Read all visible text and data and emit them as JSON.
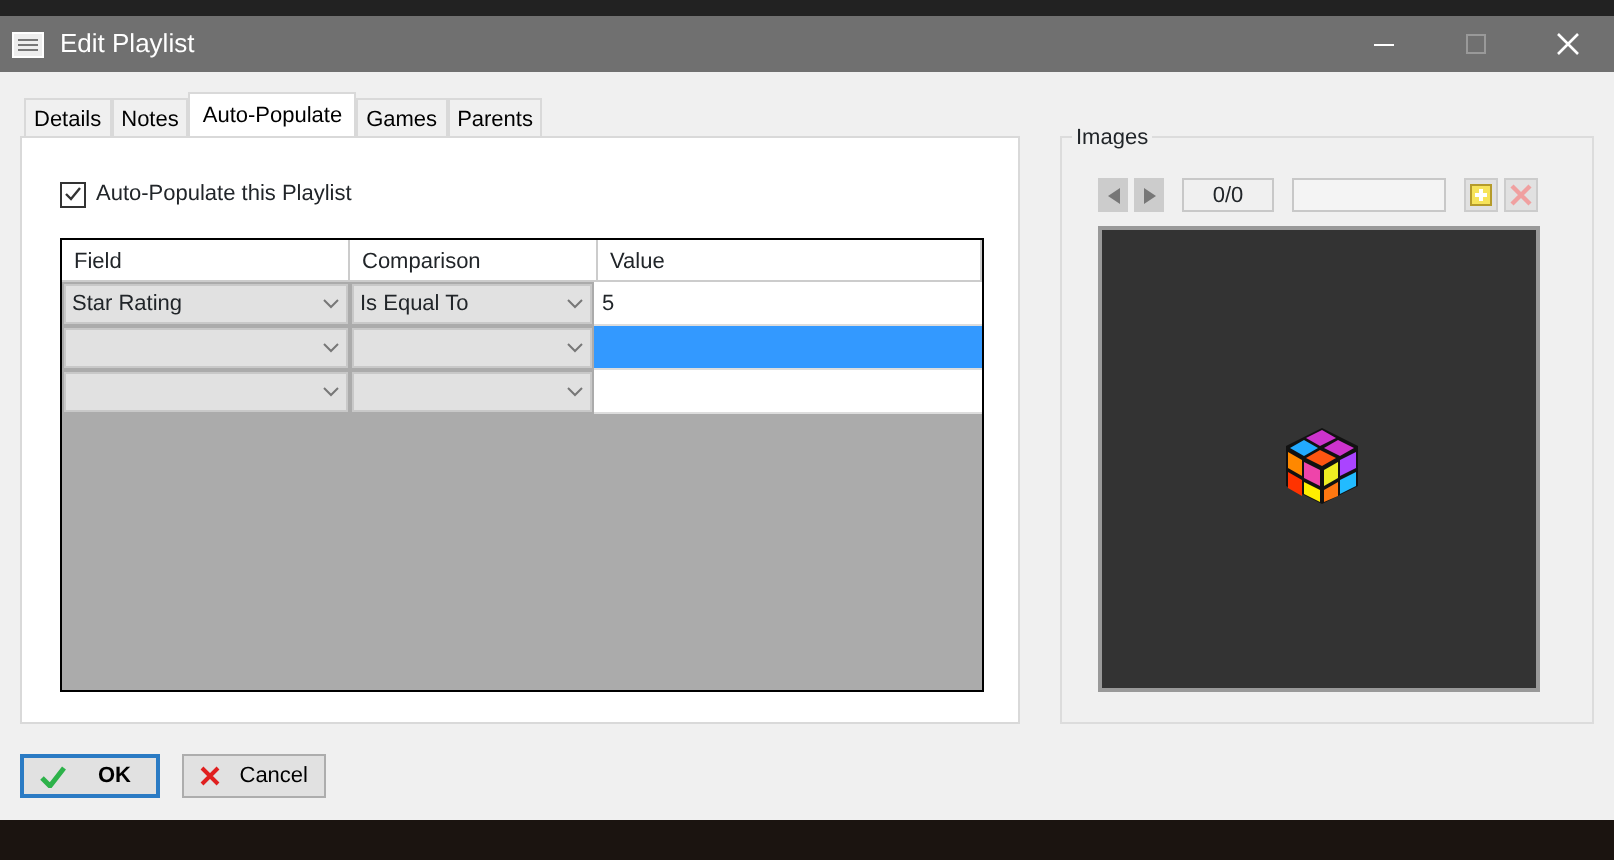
{
  "window": {
    "title": "Edit Playlist",
    "maximize_disabled": true
  },
  "tabs": [
    {
      "label": "Details",
      "selected": false
    },
    {
      "label": "Notes",
      "selected": false
    },
    {
      "label": "Auto-Populate",
      "selected": true
    },
    {
      "label": "Games",
      "selected": false
    },
    {
      "label": "Parents",
      "selected": false
    }
  ],
  "auto_populate": {
    "label": "Auto-Populate this Playlist",
    "checked": true
  },
  "grid": {
    "columns": [
      "Field",
      "Comparison",
      "Value"
    ],
    "rows": [
      {
        "field": "Star Rating",
        "comparison": "Is Equal To",
        "value": "5",
        "selected": false
      },
      {
        "selected": true
      },
      {
        "selected": false
      }
    ]
  },
  "images": {
    "title": "Images",
    "counter": "0/0",
    "delete_disabled": true
  },
  "buttons": [
    {
      "label": "OK",
      "kind": "ok",
      "default": true
    },
    {
      "label": "Cancel",
      "kind": "cancel",
      "default": false
    }
  ]
}
